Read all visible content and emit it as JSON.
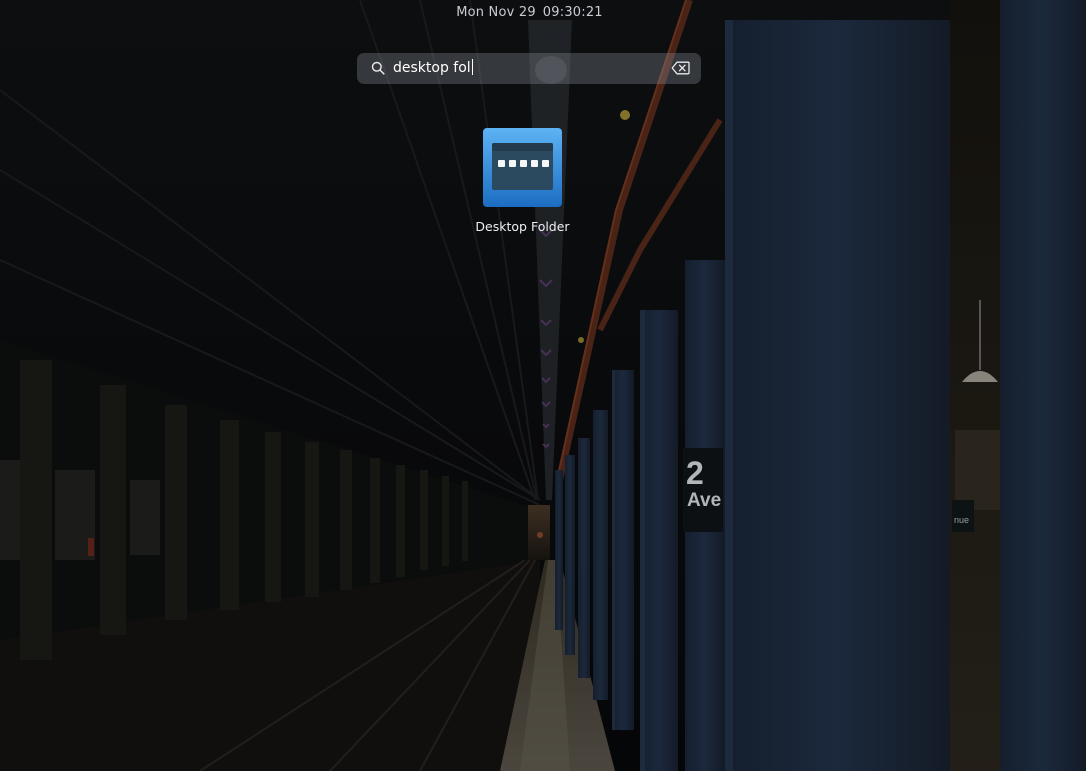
{
  "clock": {
    "date": "Mon Nov 29",
    "time": "09:30:21"
  },
  "search": {
    "query": "desktop fol",
    "icon": "magnifier-icon",
    "clear_icon": "clear-backspace-icon"
  },
  "results": [
    {
      "label": "Desktop Folder",
      "icon": "desktop-folder-app-icon"
    }
  ],
  "wallpaper": {
    "sign_line": "2",
    "sign_text": "Ave",
    "sign_text_right": "nue"
  },
  "colors": {
    "search_bg": "rgba(150,155,165,0.30)",
    "icon_blue_light": "#4fa8f0",
    "icon_blue_dark": "#1f6fc2",
    "icon_panel": "#2d4a5e"
  }
}
